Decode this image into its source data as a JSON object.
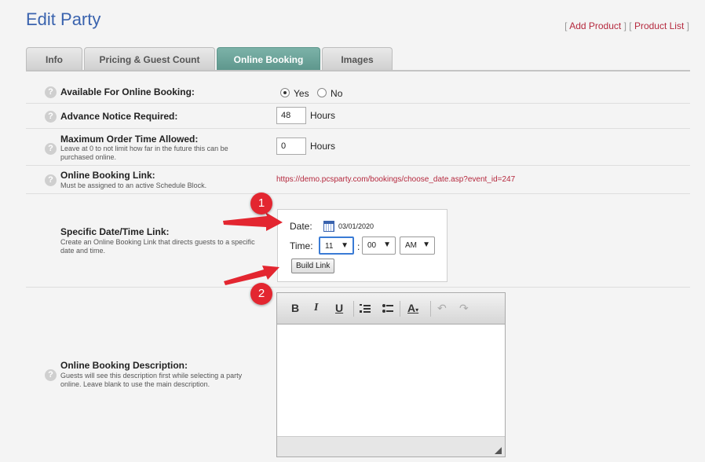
{
  "page": {
    "title": "Edit Party"
  },
  "top_links": {
    "open": "[",
    "mid": "] [",
    "close": "]",
    "add_product": "Add Product",
    "product_list": "Product List"
  },
  "tabs": [
    {
      "label": "Info"
    },
    {
      "label": "Pricing & Guest Count"
    },
    {
      "label": "Online Booking"
    },
    {
      "label": "Images"
    }
  ],
  "help_glyph": "?",
  "rows": {
    "available": {
      "label": "Available For Online Booking:",
      "yes": "Yes",
      "no": "No",
      "selected": "Yes"
    },
    "advance": {
      "label": "Advance Notice Required:",
      "value": "48",
      "unit": "Hours"
    },
    "maxorder": {
      "label": "Maximum Order Time Allowed:",
      "desc": "Leave at 0 to not limit how far in the future this can be purchased online.",
      "value": "0",
      "unit": "Hours"
    },
    "link": {
      "label": "Online Booking Link:",
      "desc": "Must be assigned to an active Schedule Block.",
      "url": "https://demo.pcsparty.com/bookings/choose_date.asp?event_id=247"
    },
    "specific": {
      "label": "Specific Date/Time Link:",
      "desc": "Create an Online Booking Link that directs guests to a specific date and time.",
      "date_label": "Date:",
      "date_value": "03/01/2020",
      "time_label": "Time:",
      "hour": "11",
      "minute": "00",
      "ampm": "AM",
      "colon": ":",
      "button": "Build Link"
    },
    "description": {
      "label": "Online Booking Description:",
      "desc": "Guests will see this description first while selecting a party online. Leave blank to use the main description."
    }
  },
  "annotations": {
    "one": "1",
    "two": "2",
    "arrow_color": "#e32630"
  },
  "editor": {
    "bold": "B",
    "italic": "I",
    "underline": "U",
    "ordered_list": "ordered-list-icon",
    "bullet_list": "bullet-list-icon",
    "font_color": "A",
    "undo": "undo-icon",
    "redo": "redo-icon"
  },
  "colors": {
    "accent": "#3a63ae",
    "tab_active": "#6aa39a",
    "link": "#b5293e"
  }
}
